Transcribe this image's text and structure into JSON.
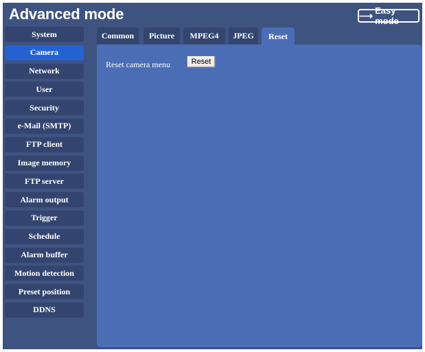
{
  "header": {
    "title": "Advanced mode",
    "easy_mode_label": "Easy mode"
  },
  "sidebar": {
    "items": [
      {
        "label": "System",
        "active": false
      },
      {
        "label": "Camera",
        "active": true
      },
      {
        "label": "Network",
        "active": false
      },
      {
        "label": "User",
        "active": false
      },
      {
        "label": "Security",
        "active": false
      },
      {
        "label": "e-Mail (SMTP)",
        "active": false
      },
      {
        "label": "FTP client",
        "active": false
      },
      {
        "label": "Image memory",
        "active": false
      },
      {
        "label": "FTP server",
        "active": false
      },
      {
        "label": "Alarm output",
        "active": false
      },
      {
        "label": "Trigger",
        "active": false
      },
      {
        "label": "Schedule",
        "active": false
      },
      {
        "label": "Alarm buffer",
        "active": false
      },
      {
        "label": "Motion detection",
        "active": false
      },
      {
        "label": "Preset position",
        "active": false
      },
      {
        "label": "DDNS",
        "active": false
      }
    ]
  },
  "tabs": [
    {
      "label": "Common",
      "active": false
    },
    {
      "label": "Picture",
      "active": false
    },
    {
      "label": "MPEG4",
      "active": false
    },
    {
      "label": "JPEG",
      "active": false
    },
    {
      "label": "Reset",
      "active": true
    }
  ],
  "main": {
    "reset_label": "Reset camera menu",
    "reset_button": "Reset"
  },
  "colors": {
    "background": "#3f5381",
    "nav_item": "#33446f",
    "nav_active": "#2462d2",
    "panel": "#4b6db5"
  },
  "icons": {
    "easy_mode": "arrow-right-icon"
  }
}
